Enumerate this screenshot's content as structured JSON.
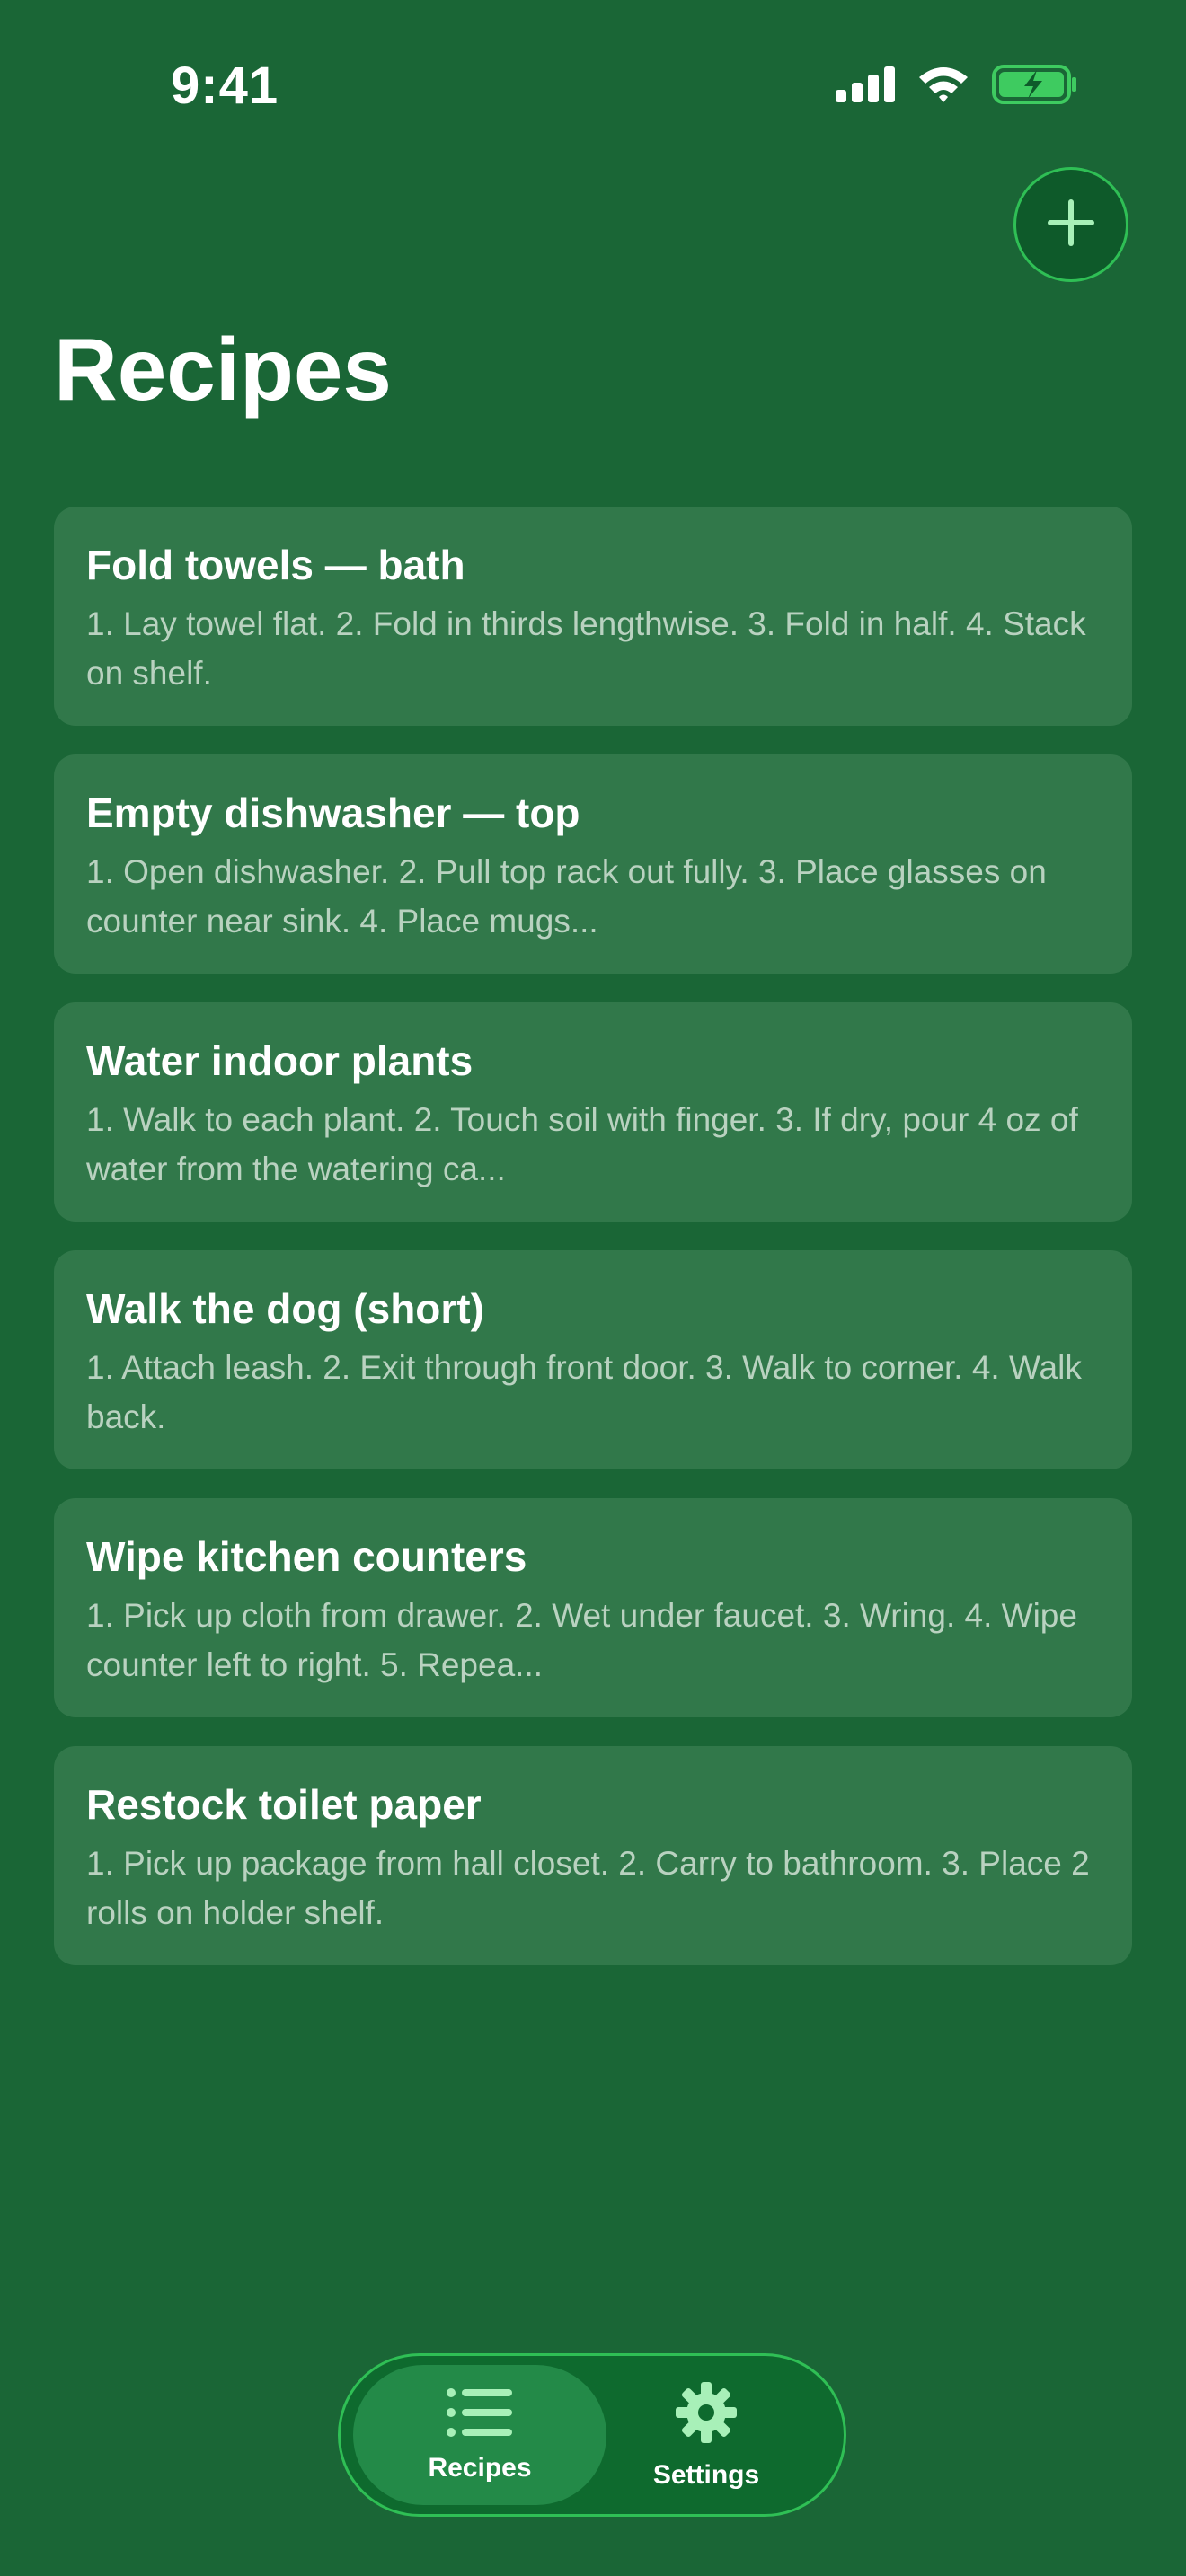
{
  "status_bar": {
    "time": "9:41"
  },
  "colors": {
    "background": "#1a6636",
    "card": "#31784a",
    "accent": "#2fbf55",
    "tab_icon": "#a8f0b8"
  },
  "header": {
    "title": "Recipes",
    "add_icon": "plus-icon"
  },
  "recipes": [
    {
      "title": "Fold towels — bath",
      "description": "1. Lay towel flat. 2. Fold in thirds lengthwise. 3. Fold in half. 4. Stack on shelf."
    },
    {
      "title": "Empty dishwasher — top",
      "description": "1. Open dishwasher. 2. Pull top rack out fully. 3. Place glasses on counter near sink. 4. Place mugs..."
    },
    {
      "title": "Water indoor plants",
      "description": "1. Walk to each plant. 2. Touch soil with finger. 3. If dry, pour 4 oz of water from the watering ca..."
    },
    {
      "title": "Walk the dog (short)",
      "description": "1. Attach leash. 2. Exit through front door. 3. Walk to corner. 4. Walk back."
    },
    {
      "title": "Wipe kitchen counters",
      "description": "1. Pick up cloth from drawer. 2. Wet under faucet. 3. Wring. 4. Wipe counter left to right. 5. Repea..."
    },
    {
      "title": "Restock toilet paper",
      "description": "1. Pick up package from hall closet. 2. Carry to bathroom. 3. Place 2 rolls on holder shelf."
    }
  ],
  "tab_bar": {
    "tabs": [
      {
        "label": "Recipes",
        "icon": "list-icon",
        "selected": true
      },
      {
        "label": "Settings",
        "icon": "gear-icon",
        "selected": false
      }
    ]
  }
}
